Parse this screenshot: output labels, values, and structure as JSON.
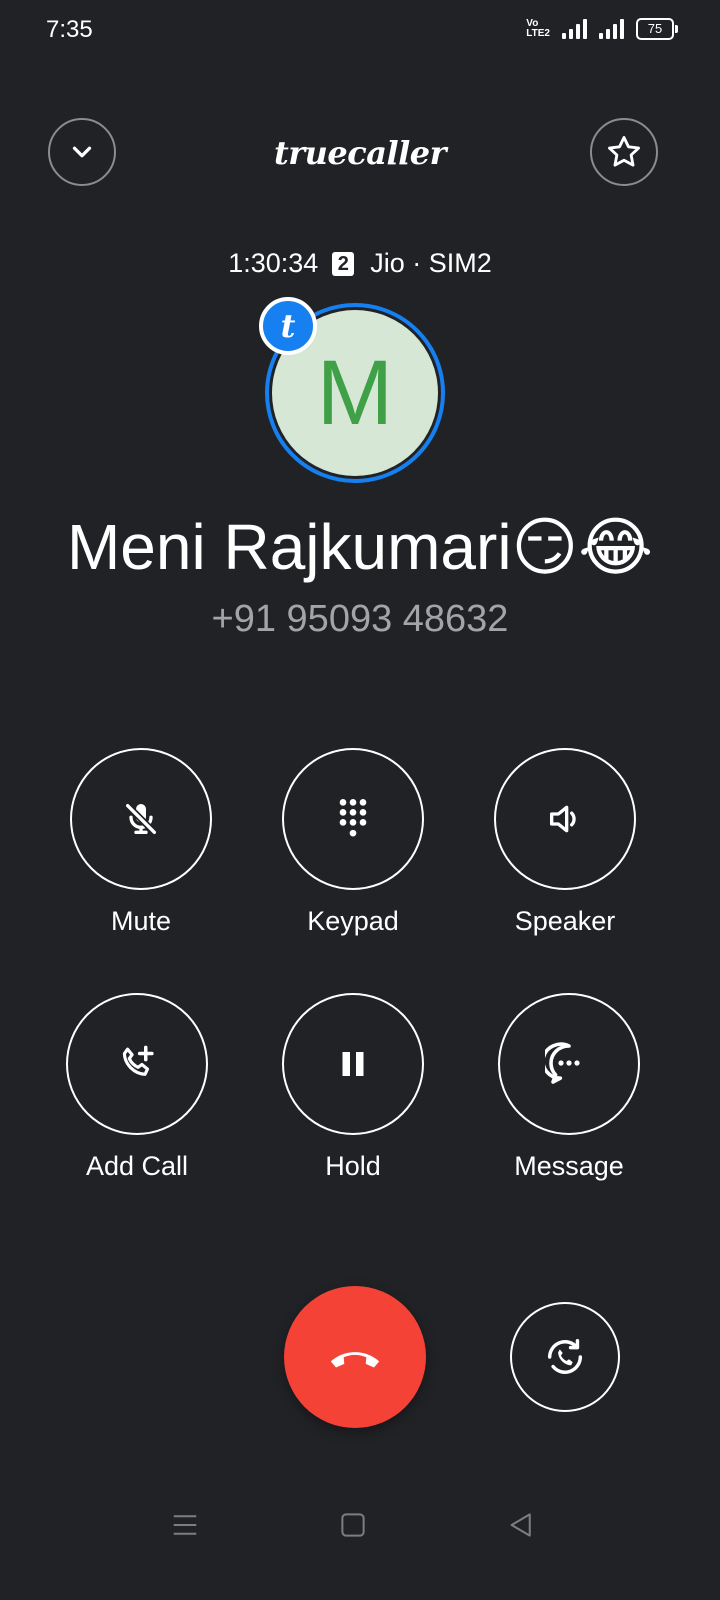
{
  "status_bar": {
    "time": "7:35",
    "volte_line1": "Vo",
    "volte_line2": "LTE2",
    "battery": "75"
  },
  "header": {
    "brand": "truecaller",
    "collapse_icon": "chevron-down-icon",
    "favorite_icon": "star-outline-icon"
  },
  "call": {
    "duration": "1:30:34",
    "sim_slot": "2",
    "carrier": "Jio · SIM2"
  },
  "contact": {
    "initial": "M",
    "badge_letter": "t",
    "name": "Meni Rajkumari😏😂",
    "number": "+91 95093 48632"
  },
  "actions": [
    {
      "label": "Mute",
      "icon": "mic-off-icon"
    },
    {
      "label": "Keypad",
      "icon": "dialpad-icon"
    },
    {
      "label": "Speaker",
      "icon": "speaker-icon"
    },
    {
      "label": "Add Call",
      "icon": "add-call-icon"
    },
    {
      "label": "Hold",
      "icon": "pause-icon"
    },
    {
      "label": "Message",
      "icon": "message-icon"
    }
  ],
  "colors": {
    "background": "#212226",
    "end_call": "#f44336",
    "truecaller_blue": "#1780f0",
    "avatar_bg": "#d6e7d6",
    "avatar_letter": "#3fa047"
  }
}
